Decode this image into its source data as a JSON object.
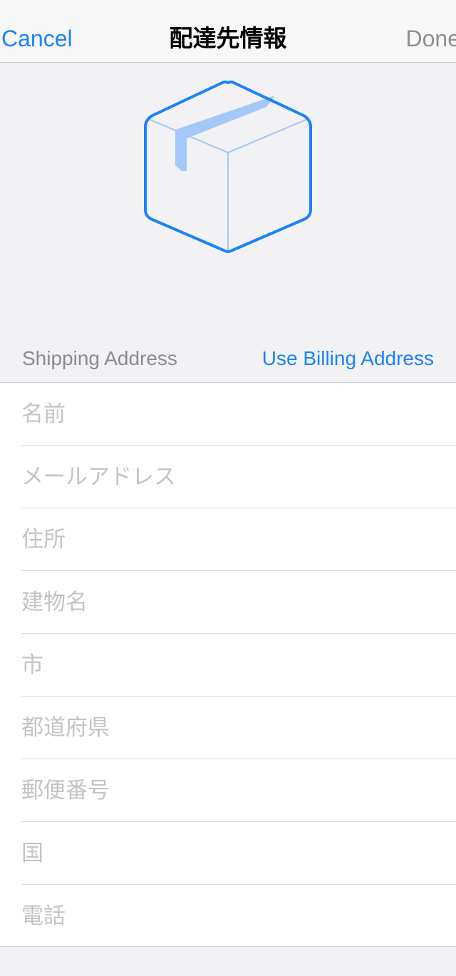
{
  "nav": {
    "cancel_label": "Cancel",
    "title": "配達先情報",
    "done_label": "Done"
  },
  "icon": {
    "name": "package-box-icon",
    "accent_color": "#1a82fb",
    "tape_color": "#a4c8f8"
  },
  "section": {
    "label": "Shipping Address",
    "billing_link": "Use Billing Address"
  },
  "fields": [
    {
      "placeholder": "名前"
    },
    {
      "placeholder": "メールアドレス"
    },
    {
      "placeholder": "住所"
    },
    {
      "placeholder": "建物名"
    },
    {
      "placeholder": "市"
    },
    {
      "placeholder": "都道府県"
    },
    {
      "placeholder": "郵便番号"
    },
    {
      "placeholder": "国"
    },
    {
      "placeholder": "電話"
    }
  ]
}
